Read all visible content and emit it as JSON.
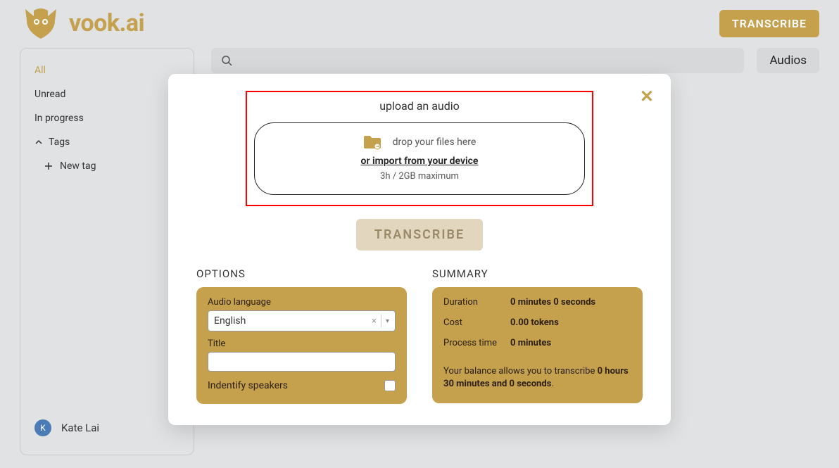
{
  "brand": "vook.ai",
  "top_button": "TRANSCRIBE",
  "sidebar": {
    "items": [
      "All",
      "Unread",
      "In progress"
    ],
    "tags_label": "Tags",
    "new_tag_label": "New tag"
  },
  "user": {
    "initial": "K",
    "name": "Kate Lai"
  },
  "content": {
    "audios_label": "Audios"
  },
  "modal": {
    "upload_title": "upload an audio",
    "drop_text": "drop your files here",
    "import_link": "or import from your device",
    "max_text": "3h / 2GB maximum",
    "transcribe_button": "TRANSCRIBE",
    "options": {
      "heading": "OPTIONS",
      "lang_label": "Audio language",
      "lang_value": "English",
      "title_label": "Title",
      "title_value": "",
      "speakers_label": "Indentify speakers"
    },
    "summary": {
      "heading": "SUMMARY",
      "duration_label": "Duration",
      "duration_value": "0 minutes 0 seconds",
      "cost_label": "Cost",
      "cost_value": "0.00 tokens",
      "process_label": "Process time",
      "process_value": "0 minutes",
      "balance_prefix": "Your balance allows you to transcribe ",
      "balance_bold": "0 hours 30 minutes and 0 seconds",
      "balance_suffix": "."
    }
  }
}
